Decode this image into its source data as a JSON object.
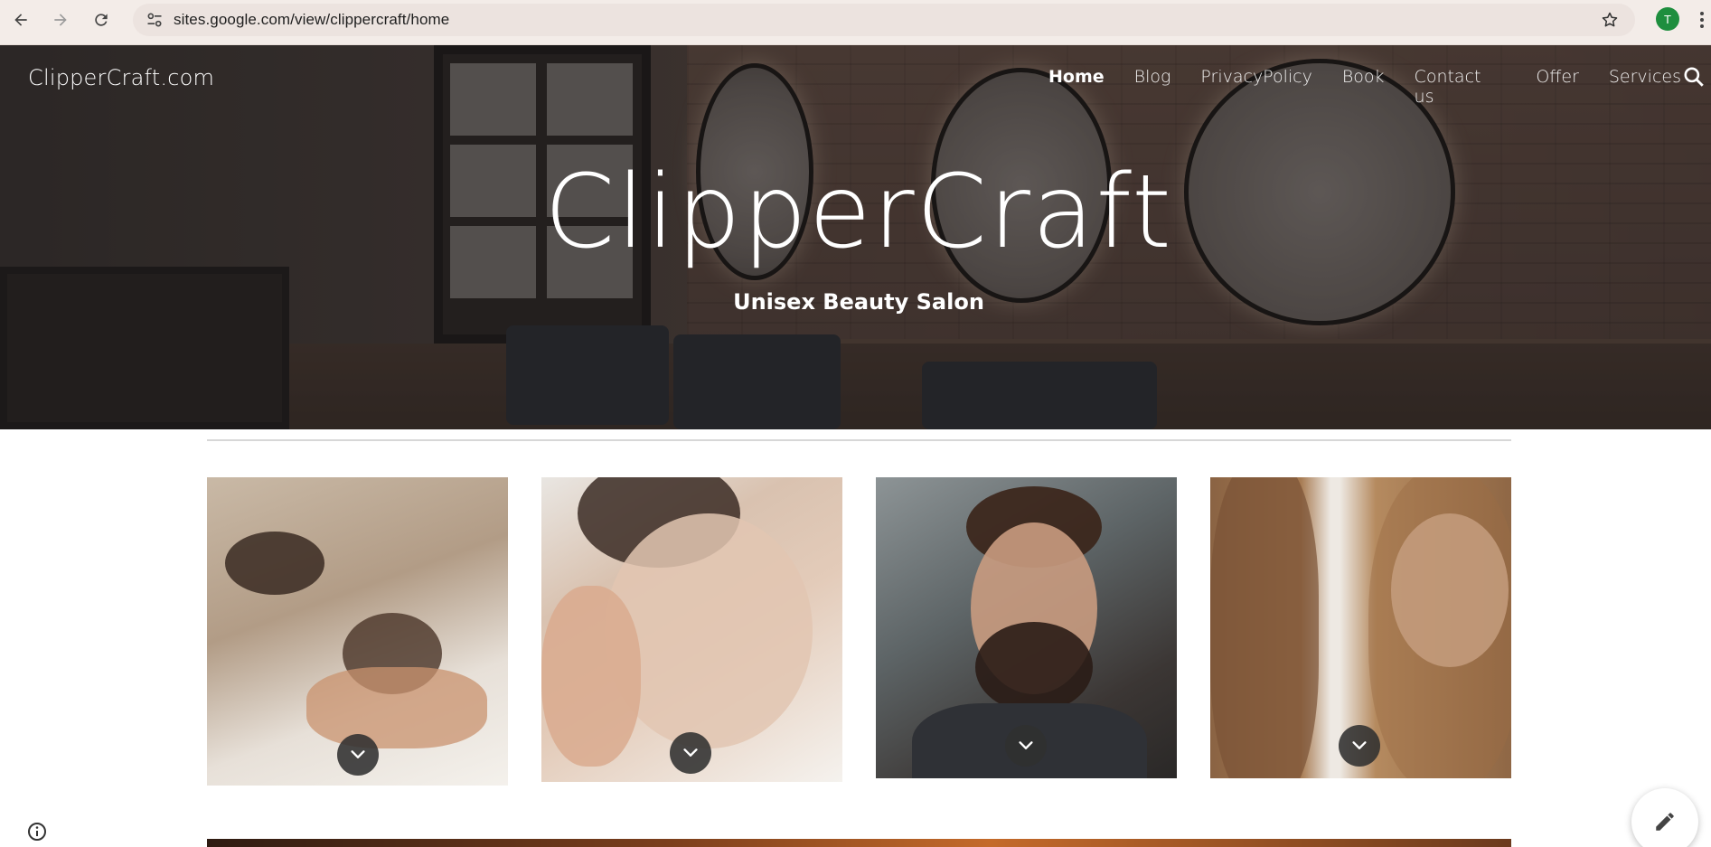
{
  "browser": {
    "url": "sites.google.com/view/clippercraft/home",
    "profile_initial": "T",
    "icons": [
      "back-arrow-icon",
      "forward-arrow-icon",
      "reload-icon",
      "site-info-icon",
      "bookmark-star-icon",
      "kebab-menu-icon"
    ]
  },
  "site": {
    "logo_text": "ClipperCraft.com",
    "nav": [
      "Home",
      "Blog",
      "PrivacyPolicy",
      "Book",
      "Contact us",
      "Offer",
      "Services"
    ],
    "active_nav": "Home"
  },
  "hero": {
    "title": "ClipperCraft",
    "subtitle": "Unisex Beauty Salon"
  },
  "cards": [
    {
      "subject": "massage",
      "icon": "chevron-down-icon"
    },
    {
      "subject": "facial",
      "icon": "chevron-down-icon"
    },
    {
      "subject": "beard-styling",
      "icon": "chevron-down-icon"
    },
    {
      "subject": "hair-styling",
      "icon": "chevron-down-icon"
    }
  ],
  "colors": {
    "browser_bar": "#f3ece8",
    "text_on_hero": "#ffffff",
    "chevron_button": "#303030",
    "profile_avatar": "#1e8e3e"
  }
}
